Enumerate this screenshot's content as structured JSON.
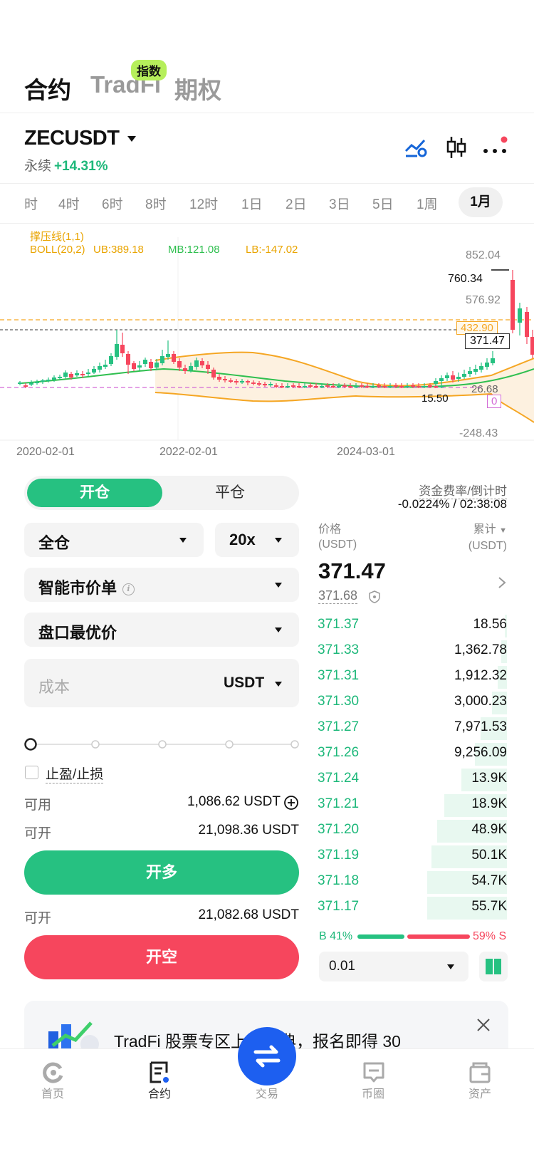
{
  "top_tabs": {
    "futures": "合约",
    "tradfi": "TradFi",
    "tradfi_badge": "指数",
    "options": "期权"
  },
  "symbol": {
    "name": "ZECUSDT",
    "type": "永续",
    "change": "+14.31%"
  },
  "timeframes": [
    "时",
    "4时",
    "6时",
    "8时",
    "12时",
    "1日",
    "2日",
    "3日",
    "5日",
    "1周",
    "1月"
  ],
  "active_timeframe": "1月",
  "chart": {
    "indicator_name": "撑压线(1,1)",
    "boll_label": "BOLL(20,2)",
    "ub": "UB:389.18",
    "mb": "MB:121.08",
    "lb": "LB:-147.02",
    "y_ticks": [
      "852.04",
      "576.92",
      "-248.43"
    ],
    "high_marker": "760.34",
    "resistance_label": "432.90",
    "last_price_label": "371.47",
    "support_label": "26.68",
    "low_marker": "15.50",
    "zero_label": "0",
    "x_labels": [
      "2020-02-01",
      "2022-02-01",
      "2024-03-01"
    ],
    "colors": {
      "up": "#26c181",
      "down": "#f6465d",
      "ub": "#f5a623",
      "mb": "#2fbf4f",
      "lb": "#f5a623"
    }
  },
  "order_form": {
    "open_tab": "开仓",
    "close_tab": "平仓",
    "margin_mode": "全仓",
    "leverage": "20x",
    "order_type": "智能市价单",
    "price_type": "盘口最优价",
    "amount_placeholder": "成本",
    "amount_unit": "USDT",
    "tp_sl": "止盈/止损",
    "available_label": "可用",
    "available_value": "1,086.62 USDT",
    "can_open_label": "可开",
    "can_open_long": "21,098.36 USDT",
    "long_button": "开多",
    "can_open_short": "21,082.68 USDT",
    "short_button": "开空",
    "slider_value": 0
  },
  "funding": {
    "label": "资金费率/倒计时",
    "value": "-0.0224% / 02:38:08"
  },
  "orderbook": {
    "price_header": "价格",
    "price_unit": "(USDT)",
    "qty_header": "累计",
    "qty_unit": "(USDT)",
    "last_price": "371.47",
    "mark_price": "371.68",
    "rows": [
      {
        "price": "371.37",
        "qty": "18.56",
        "depth": 0.01
      },
      {
        "price": "371.33",
        "qty": "1,362.78",
        "depth": 0.03
      },
      {
        "price": "371.31",
        "qty": "1,912.32",
        "depth": 0.05
      },
      {
        "price": "371.30",
        "qty": "3,000.23",
        "depth": 0.08
      },
      {
        "price": "371.27",
        "qty": "7,971.53",
        "depth": 0.14
      },
      {
        "price": "371.26",
        "qty": "9,256.09",
        "depth": 0.17
      },
      {
        "price": "371.24",
        "qty": "13.9K",
        "depth": 0.24
      },
      {
        "price": "371.21",
        "qty": "18.9K",
        "depth": 0.33
      },
      {
        "price": "371.20",
        "qty": "48.9K",
        "depth": 0.37
      },
      {
        "price": "371.19",
        "qty": "50.1K",
        "depth": 0.4
      },
      {
        "price": "371.18",
        "qty": "54.7K",
        "depth": 0.42
      },
      {
        "price": "371.17",
        "qty": "55.7K",
        "depth": 0.42
      }
    ],
    "buy_ratio": "B 41%",
    "sell_ratio": "59% S",
    "buy_pct": 41,
    "precision": "0.01"
  },
  "banner": {
    "text": "TradFi 股票专区上线庆典，报名即得 30"
  },
  "bottom_nav": {
    "home": "首页",
    "futures": "合约",
    "trade": "交易",
    "square": "币圈",
    "assets": "资产"
  }
}
